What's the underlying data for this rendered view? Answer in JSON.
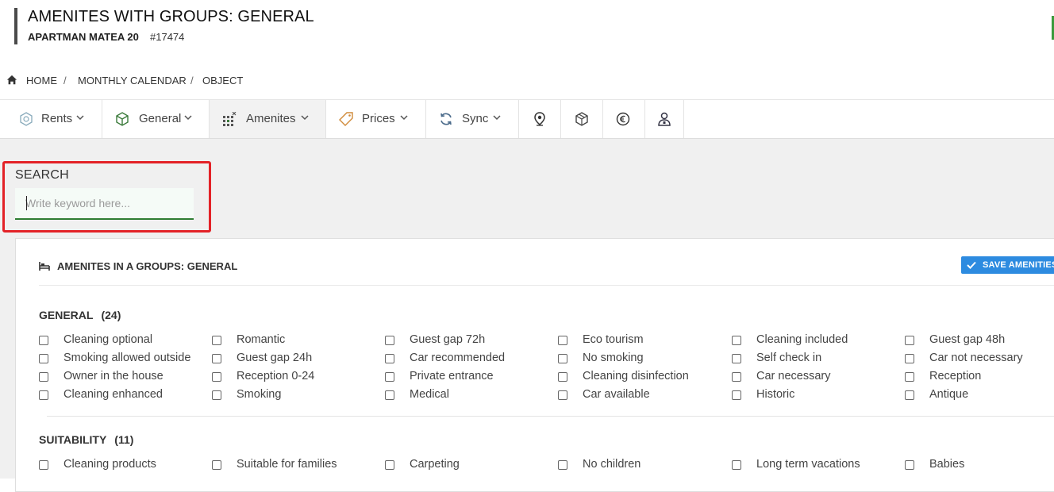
{
  "header": {
    "title": "AMENITES WITH GROUPS: GENERAL",
    "object_name": "APARTMAN MATEA 20",
    "object_id": "#17474"
  },
  "breadcrumb": {
    "items": [
      "HOME",
      "MONTHLY CALENDAR",
      "OBJECT"
    ],
    "separator": "/"
  },
  "tabs": [
    {
      "label": "Rents",
      "icon": "rents-icon"
    },
    {
      "label": "General",
      "icon": "cube-icon"
    },
    {
      "label": "Amenites",
      "icon": "amenities-icon"
    },
    {
      "label": "Prices",
      "icon": "tag-icon"
    },
    {
      "label": "Sync",
      "icon": "sync-icon"
    },
    {
      "label": "",
      "icon": "map-pin-icon"
    },
    {
      "label": "",
      "icon": "package-icon"
    },
    {
      "label": "",
      "icon": "euro-icon"
    },
    {
      "label": "",
      "icon": "user-icon"
    }
  ],
  "search": {
    "label": "SEARCH",
    "placeholder": "Write keyword here...",
    "value": ""
  },
  "panel": {
    "title": "AMENITES IN A GROUPS: GENERAL",
    "save_label": "SAVE AMENITIES"
  },
  "groups": [
    {
      "name": "GENERAL",
      "count": "(24)",
      "items": [
        [
          "Cleaning optional",
          "Romantic",
          "Guest gap 72h",
          "Eco tourism",
          "Cleaning included",
          "Guest gap 48h"
        ],
        [
          "Smoking allowed outside",
          "Guest gap 24h",
          "Car recommended",
          "No smoking",
          "Self check in",
          "Car not necessary"
        ],
        [
          "Owner in the house",
          "Reception 0-24",
          "Private entrance",
          "Cleaning disinfection",
          "Car necessary",
          "Reception"
        ],
        [
          "Cleaning enhanced",
          "Smoking",
          "Medical",
          "Car available",
          "Historic",
          "Antique"
        ]
      ]
    },
    {
      "name": "SUITABILITY",
      "count": "(11)",
      "items": [
        [
          "Cleaning products",
          "Suitable for families",
          "Carpeting",
          "No children",
          "Long term vacations",
          "Babies"
        ]
      ]
    }
  ],
  "colors": {
    "highlight_border": "#e32227",
    "save_button": "#2d8be0",
    "input_underline": "#2e7d32"
  }
}
